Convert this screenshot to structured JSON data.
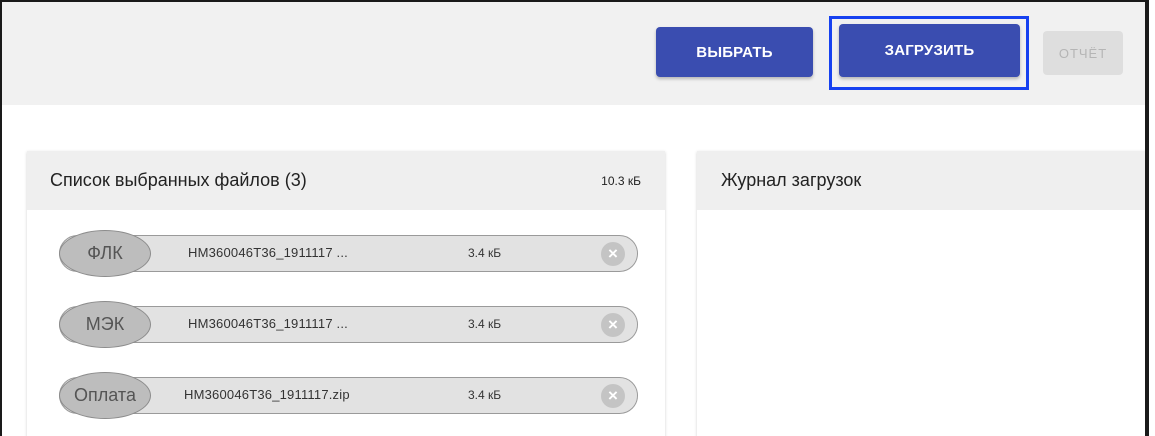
{
  "toolbar": {
    "select_label": "ВЫБРАТЬ",
    "upload_label": "ЗАГРУЗИТЬ",
    "report_label": "ОТЧЁТ"
  },
  "files_panel": {
    "title": "Список выбранных файлов (3)",
    "total_size": "10.3 кБ",
    "files": [
      {
        "type": "ФЛК",
        "name": "HM360046T36_1911117 ...",
        "size": "3.4 кБ",
        "remove_icon": "close-circle-icon"
      },
      {
        "type": "МЭК",
        "name": "HM360046T36_1911117 ...",
        "size": "3.4 кБ",
        "remove_icon": "close-circle-icon"
      },
      {
        "type": "Оплата",
        "name": "HM360046T36_1911117.zip",
        "size": "3.4 кБ",
        "remove_icon": "close-circle-icon"
      }
    ]
  },
  "log_panel": {
    "title": "Журнал загрузок"
  },
  "colors": {
    "primary_button": "#3a4db0",
    "focus_ring": "#1641f0",
    "disabled_button": "#dedede",
    "chip": "#bdbdbd",
    "file_row": "#e2e2e2"
  }
}
